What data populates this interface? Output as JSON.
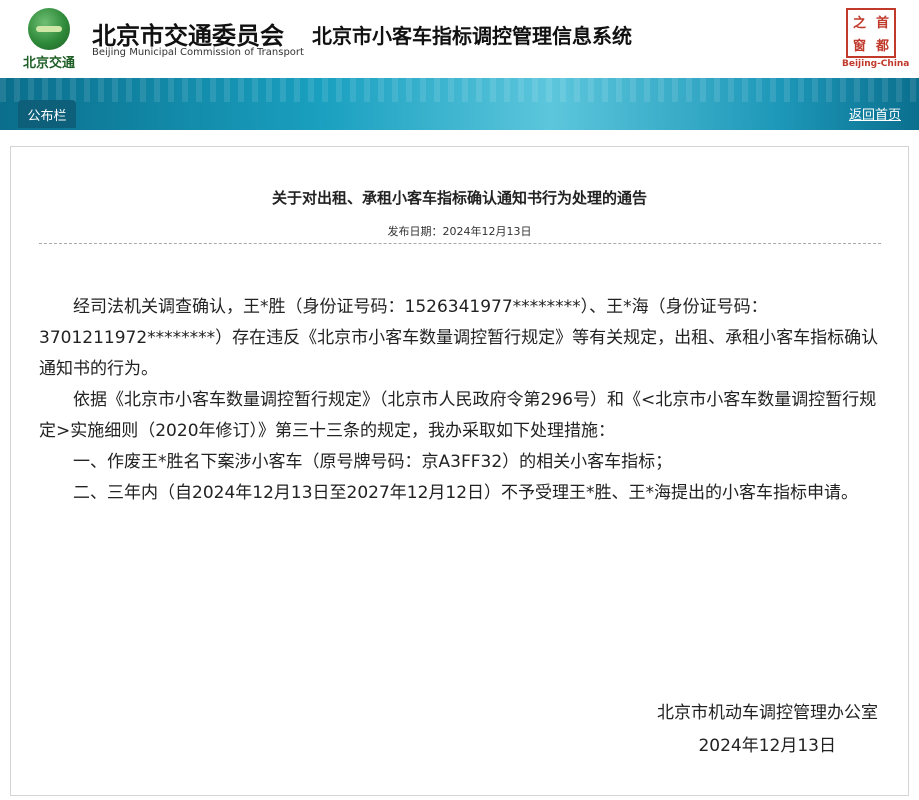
{
  "header": {
    "logo_text": "北京交通",
    "org_title": "北京市交通委员会",
    "org_subtitle": "Beijing Municipal Commission of Transport",
    "system_title": "北京市小客车指标调控管理信息系统",
    "seal_chars": [
      "之",
      "首",
      "窗",
      "都"
    ],
    "seal_caption": "Beijing-China"
  },
  "nav": {
    "bulletin_tab": "公布栏",
    "back_home": "返回首页"
  },
  "notice": {
    "title": "关于对出租、承租小客车指标确认通知书行为处理的通告",
    "publish_date": "发布日期：2024年12月13日",
    "paragraphs": [
      "经司法机关调查确认，王*胜（身份证号码：1526341977********）、王*海（身份证号码：3701211972********）存在违反《北京市小客车数量调控暂行规定》等有关规定，出租、承租小客车指标确认通知书的行为。",
      "依据《北京市小客车数量调控暂行规定》（北京市人民政府令第296号）和《<北京市小客车数量调控暂行规定>实施细则（2020年修订）》第三十三条的规定，我办采取如下处理措施：",
      "一、作废王*胜名下案涉小客车（原号牌号码：京A3FF32）的相关小客车指标；",
      "二、三年内（自2024年12月13日至2027年12月12日）不予受理王*胜、王*海提出的小客车指标申请。"
    ],
    "signature_org": "北京市机动车调控管理办公室",
    "signature_date": "2024年12月13日"
  },
  "colors": {
    "banner_primary": "#1aa0c0",
    "tab_bg": "#0d5f7a",
    "seal_red": "#c0392b",
    "logo_green": "#2f8a3a"
  }
}
